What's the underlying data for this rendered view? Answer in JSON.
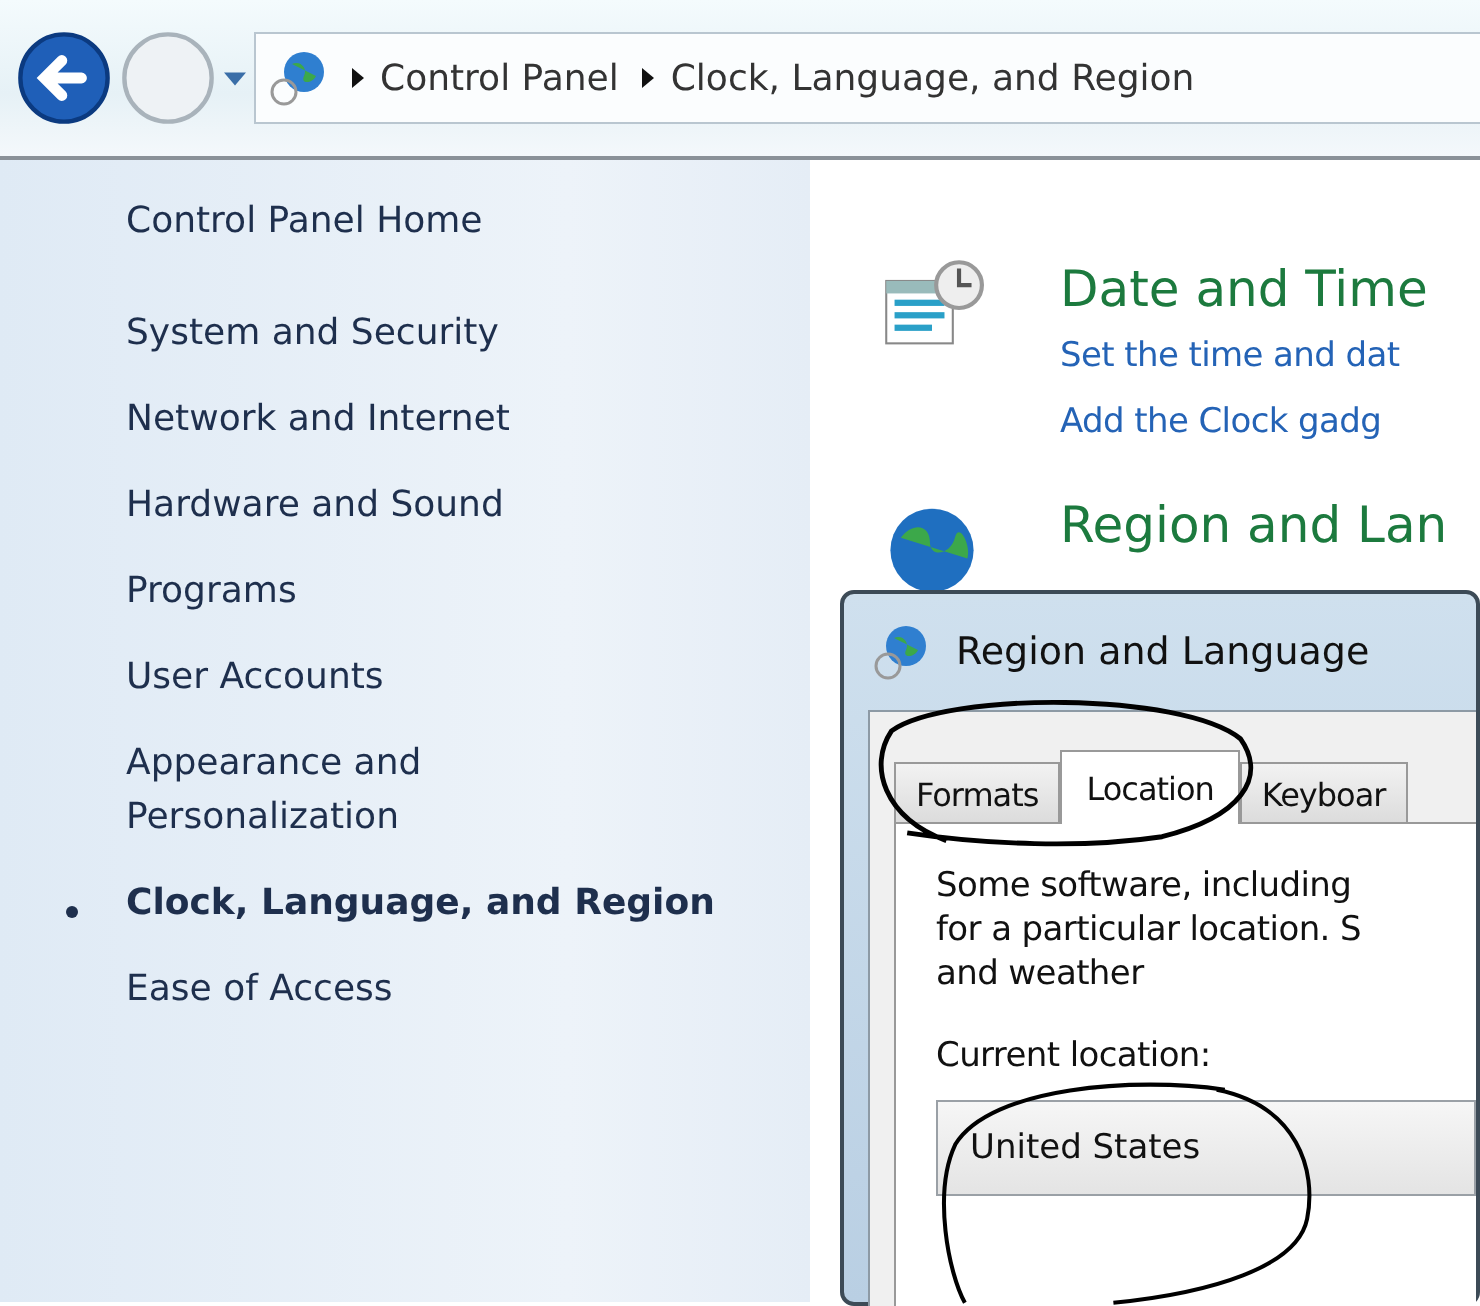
{
  "nav": {
    "breadcrumb": [
      "Control Panel",
      "Clock, Language, and Region"
    ]
  },
  "sidebar": {
    "home": "Control Panel Home",
    "items": [
      {
        "label": "System and Security",
        "selected": false
      },
      {
        "label": "Network and Internet",
        "selected": false
      },
      {
        "label": "Hardware and Sound",
        "selected": false
      },
      {
        "label": "Programs",
        "selected": false
      },
      {
        "label": "User Accounts",
        "selected": false
      },
      {
        "label": "Appearance and Personalization",
        "selected": false
      },
      {
        "label": "Clock, Language, and Region",
        "selected": true
      },
      {
        "label": "Ease of Access",
        "selected": false
      }
    ]
  },
  "sections": [
    {
      "kind": "clock",
      "title": "Date and Time",
      "links": [
        "Set the time and dat",
        "Add the Clock gadg"
      ]
    },
    {
      "kind": "globe",
      "title": "Region and Lan"
    }
  ],
  "dialog": {
    "title": "Region and Language",
    "tabs": [
      {
        "label": "Formats",
        "selected": false
      },
      {
        "label": "Location",
        "selected": true
      },
      {
        "label": "Keyboar",
        "selected": false
      }
    ],
    "description": [
      "Some software, including",
      "for a particular location. S",
      "and weather"
    ],
    "location_label": "Current location:",
    "location_value": "United States"
  }
}
